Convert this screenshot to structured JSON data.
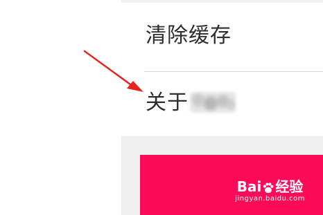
{
  "settings": {
    "items": [
      {
        "label": "清除缓存"
      },
      {
        "label": "关于"
      }
    ]
  },
  "watermark": {
    "brand_prefix": "Bai",
    "brand_suffix": "经验",
    "url": "jingyan.baidu.com"
  },
  "colors": {
    "banner": "#ff0a5a",
    "arrow": "#e8221e",
    "panel_background": "#efefef"
  },
  "icons": {
    "arrow": "annotation-arrow-icon",
    "paw": "baidu-paw-icon"
  }
}
